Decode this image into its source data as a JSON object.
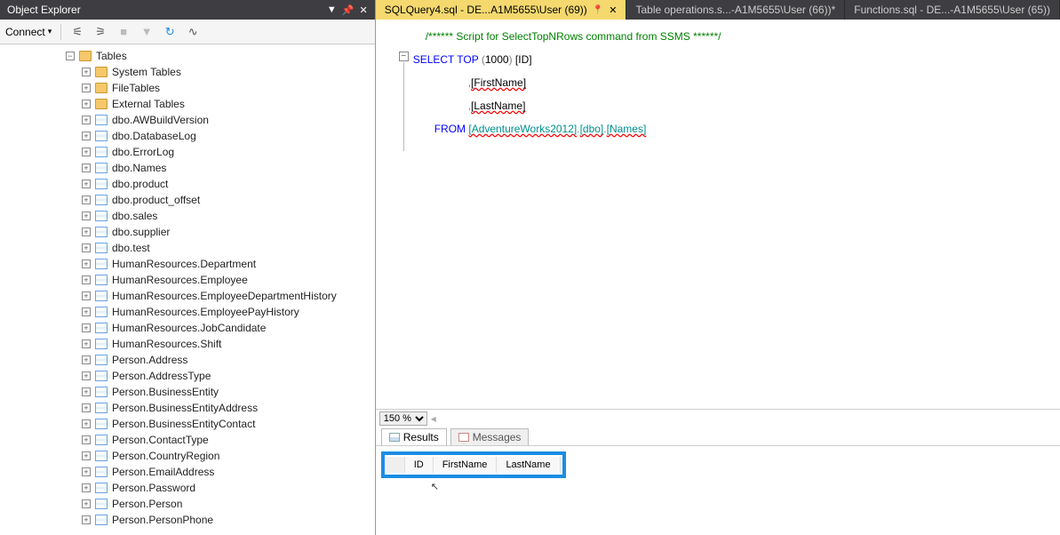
{
  "objectExplorer": {
    "title": "Object Explorer",
    "connectLabel": "Connect",
    "rootFolder": "Tables",
    "subfolders": [
      "System Tables",
      "FileTables",
      "External Tables"
    ],
    "tables": [
      "dbo.AWBuildVersion",
      "dbo.DatabaseLog",
      "dbo.ErrorLog",
      "dbo.Names",
      "dbo.product",
      "dbo.product_offset",
      "dbo.sales",
      "dbo.supplier",
      "dbo.test",
      "HumanResources.Department",
      "HumanResources.Employee",
      "HumanResources.EmployeeDepartmentHistory",
      "HumanResources.EmployeePayHistory",
      "HumanResources.JobCandidate",
      "HumanResources.Shift",
      "Person.Address",
      "Person.AddressType",
      "Person.BusinessEntity",
      "Person.BusinessEntityAddress",
      "Person.BusinessEntityContact",
      "Person.ContactType",
      "Person.CountryRegion",
      "Person.EmailAddress",
      "Person.Password",
      "Person.Person",
      "Person.PersonPhone"
    ]
  },
  "tabs": [
    {
      "label": "SQLQuery4.sql - DE...A1M5655\\User (69))",
      "active": true,
      "pinned": true
    },
    {
      "label": "Table operations.s...-A1M5655\\User (66))*",
      "active": false,
      "pinned": false
    },
    {
      "label": "Functions.sql - DE...-A1M5655\\User (65))",
      "active": false,
      "pinned": false
    }
  ],
  "sql": {
    "comment": "/****** Script for SelectTopNRows command from SSMS  ******/",
    "kw_select": "SELECT",
    "kw_top": "TOP",
    "paren_open": "(",
    "top_n": "1000",
    "paren_close": ")",
    "col_id": "[ID]",
    "comma1": ",",
    "col_first": "[FirstName]",
    "comma2": ",",
    "col_last": "[LastName]",
    "kw_from": "FROM",
    "db": "[AdventureWorks2012]",
    "dot1": ".",
    "schema": "[dbo]",
    "dot2": ".",
    "table": "[Names]"
  },
  "zoom": "150 %",
  "resultsTabs": {
    "results": "Results",
    "messages": "Messages"
  },
  "resultColumns": [
    "ID",
    "FirstName",
    "LastName"
  ]
}
